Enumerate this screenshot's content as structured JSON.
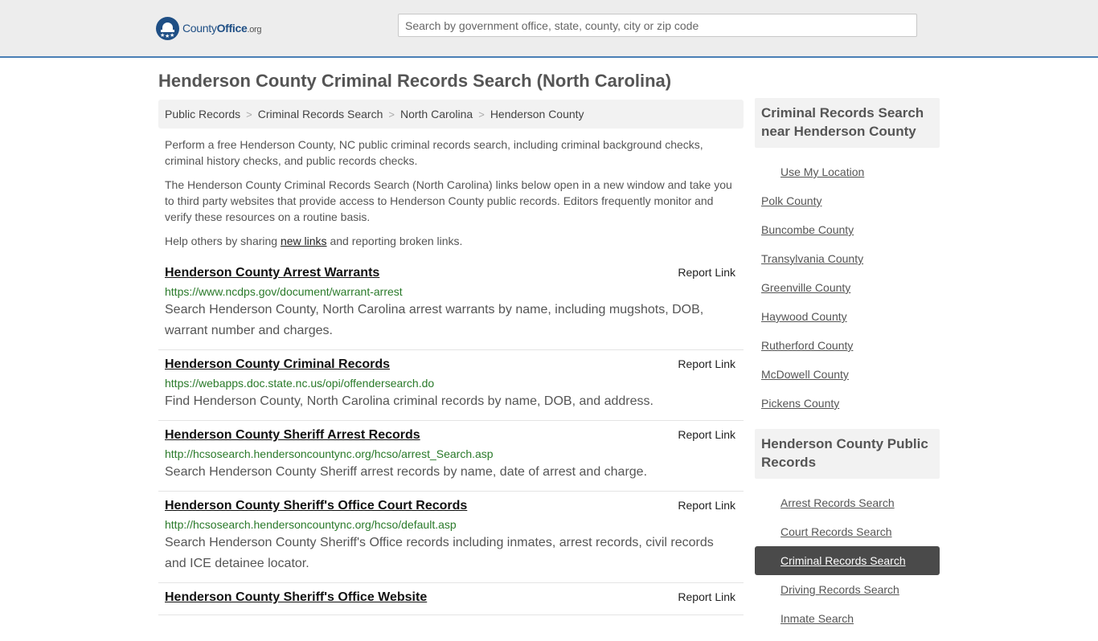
{
  "header": {
    "logo": {
      "county": "County",
      "office": "Office",
      "tld": ".org"
    },
    "search_placeholder": "Search by government office, state, county, city or zip code"
  },
  "page_title": "Henderson County Criminal Records Search (North Carolina)",
  "breadcrumb": [
    "Public Records",
    "Criminal Records Search",
    "North Carolina",
    "Henderson County"
  ],
  "intro": {
    "p1": "Perform a free Henderson County, NC public criminal records search, including criminal background checks, criminal history checks, and public records checks.",
    "p2": "The Henderson County Criminal Records Search (North Carolina) links below open in a new window and take you to third party websites that provide access to Henderson County public records. Editors frequently monitor and verify these resources on a routine basis.",
    "p3_pre": "Help others by sharing ",
    "p3_link": "new links",
    "p3_post": " and reporting broken links."
  },
  "results": [
    {
      "title": "Henderson County Arrest Warrants",
      "url": "https://www.ncdps.gov/document/warrant-arrest",
      "desc": "Search Henderson County, North Carolina arrest warrants by name, including mugshots, DOB, warrant number and charges.",
      "report": "Report Link"
    },
    {
      "title": "Henderson County Criminal Records",
      "url": "https://webapps.doc.state.nc.us/opi/offendersearch.do",
      "desc": "Find Henderson County, North Carolina criminal records by name, DOB, and address.",
      "report": "Report Link"
    },
    {
      "title": "Henderson County Sheriff Arrest Records",
      "url": "http://hcsosearch.hendersoncountync.org/hcso/arrest_Search.asp",
      "desc": "Search Henderson County Sheriff arrest records by name, date of arrest and charge.",
      "report": "Report Link"
    },
    {
      "title": "Henderson County Sheriff's Office Court Records",
      "url": "http://hcsosearch.hendersoncountync.org/hcso/default.asp",
      "desc": "Search Henderson County Sheriff's Office records including inmates, arrest records, civil records and ICE detainee locator.",
      "report": "Report Link"
    },
    {
      "title": "Henderson County Sheriff's Office Website",
      "url": "",
      "desc": "",
      "report": "Report Link"
    }
  ],
  "sidebar": {
    "nearby_title": "Criminal Records Search near Henderson County",
    "use_location": "Use My Location",
    "nearby": [
      "Polk County",
      "Buncombe County",
      "Transylvania County",
      "Greenville County",
      "Haywood County",
      "Rutherford County",
      "McDowell County",
      "Pickens County"
    ],
    "public_title": "Henderson County Public Records",
    "public_links": [
      "Arrest Records Search",
      "Court Records Search",
      "Criminal Records Search",
      "Driving Records Search",
      "Inmate Search"
    ],
    "active_index": 2
  }
}
